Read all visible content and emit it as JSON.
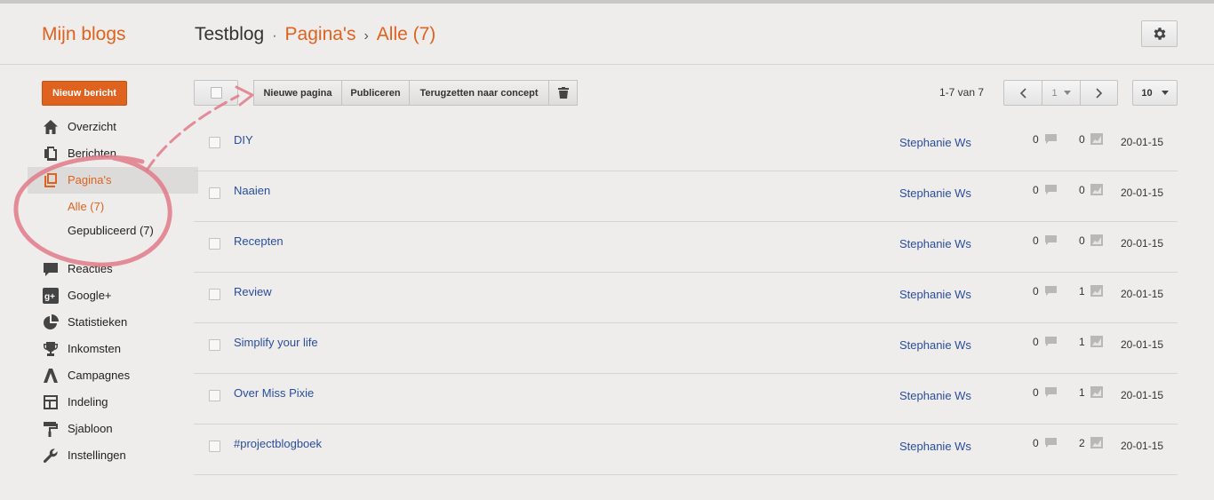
{
  "header": {
    "brand": "Mijn blogs",
    "blog_name": "Testblog",
    "sep1": "·",
    "section": "Pagina's",
    "sep2": "›",
    "filter": "Alle (7)",
    "settings_icon": "gear-icon"
  },
  "sidebar": {
    "new_post": "Nieuw bericht",
    "items": [
      {
        "label": "Overzicht",
        "icon": "home-icon"
      },
      {
        "label": "Berichten",
        "icon": "posts-icon"
      },
      {
        "label": "Pagina's",
        "icon": "pages-icon",
        "active": true
      },
      {
        "label": "Reacties",
        "icon": "comments-icon"
      },
      {
        "label": "Google+",
        "icon": "google-plus-icon"
      },
      {
        "label": "Statistieken",
        "icon": "stats-icon"
      },
      {
        "label": "Inkomsten",
        "icon": "trophy-icon"
      },
      {
        "label": "Campagnes",
        "icon": "campaigns-icon"
      },
      {
        "label": "Indeling",
        "icon": "layout-icon"
      },
      {
        "label": "Sjabloon",
        "icon": "paint-roller-icon"
      },
      {
        "label": "Instellingen",
        "icon": "wrench-icon"
      }
    ],
    "sub_items": [
      {
        "label": "Alle (7)",
        "active": true
      },
      {
        "label": "Gepubliceerd (7)",
        "active": false
      }
    ]
  },
  "toolbar": {
    "new_page": "Nieuwe pagina",
    "publish": "Publiceren",
    "revert": "Terugzetten naar concept",
    "delete_icon": "trash-icon"
  },
  "pagination": {
    "range": "1-7 van 7",
    "page": "1",
    "per_page": "10"
  },
  "pages": [
    {
      "title": "DIY",
      "author": "Stephanie Ws",
      "comments": "0",
      "views": "0",
      "date": "20-01-15"
    },
    {
      "title": "Naaien",
      "author": "Stephanie Ws",
      "comments": "0",
      "views": "0",
      "date": "20-01-15"
    },
    {
      "title": "Recepten",
      "author": "Stephanie Ws",
      "comments": "0",
      "views": "0",
      "date": "20-01-15"
    },
    {
      "title": "Review",
      "author": "Stephanie Ws",
      "comments": "0",
      "views": "1",
      "date": "20-01-15"
    },
    {
      "title": "Simplify your life",
      "author": "Stephanie Ws",
      "comments": "0",
      "views": "1",
      "date": "20-01-15"
    },
    {
      "title": "Over Miss Pixie",
      "author": "Stephanie Ws",
      "comments": "0",
      "views": "1",
      "date": "20-01-15"
    },
    {
      "title": "#projectblogboek",
      "author": "Stephanie Ws",
      "comments": "0",
      "views": "2",
      "date": "20-01-15"
    }
  ],
  "colors": {
    "accent": "#e0621f",
    "link": "#2a4d9b",
    "annotation": "#e07a88"
  }
}
